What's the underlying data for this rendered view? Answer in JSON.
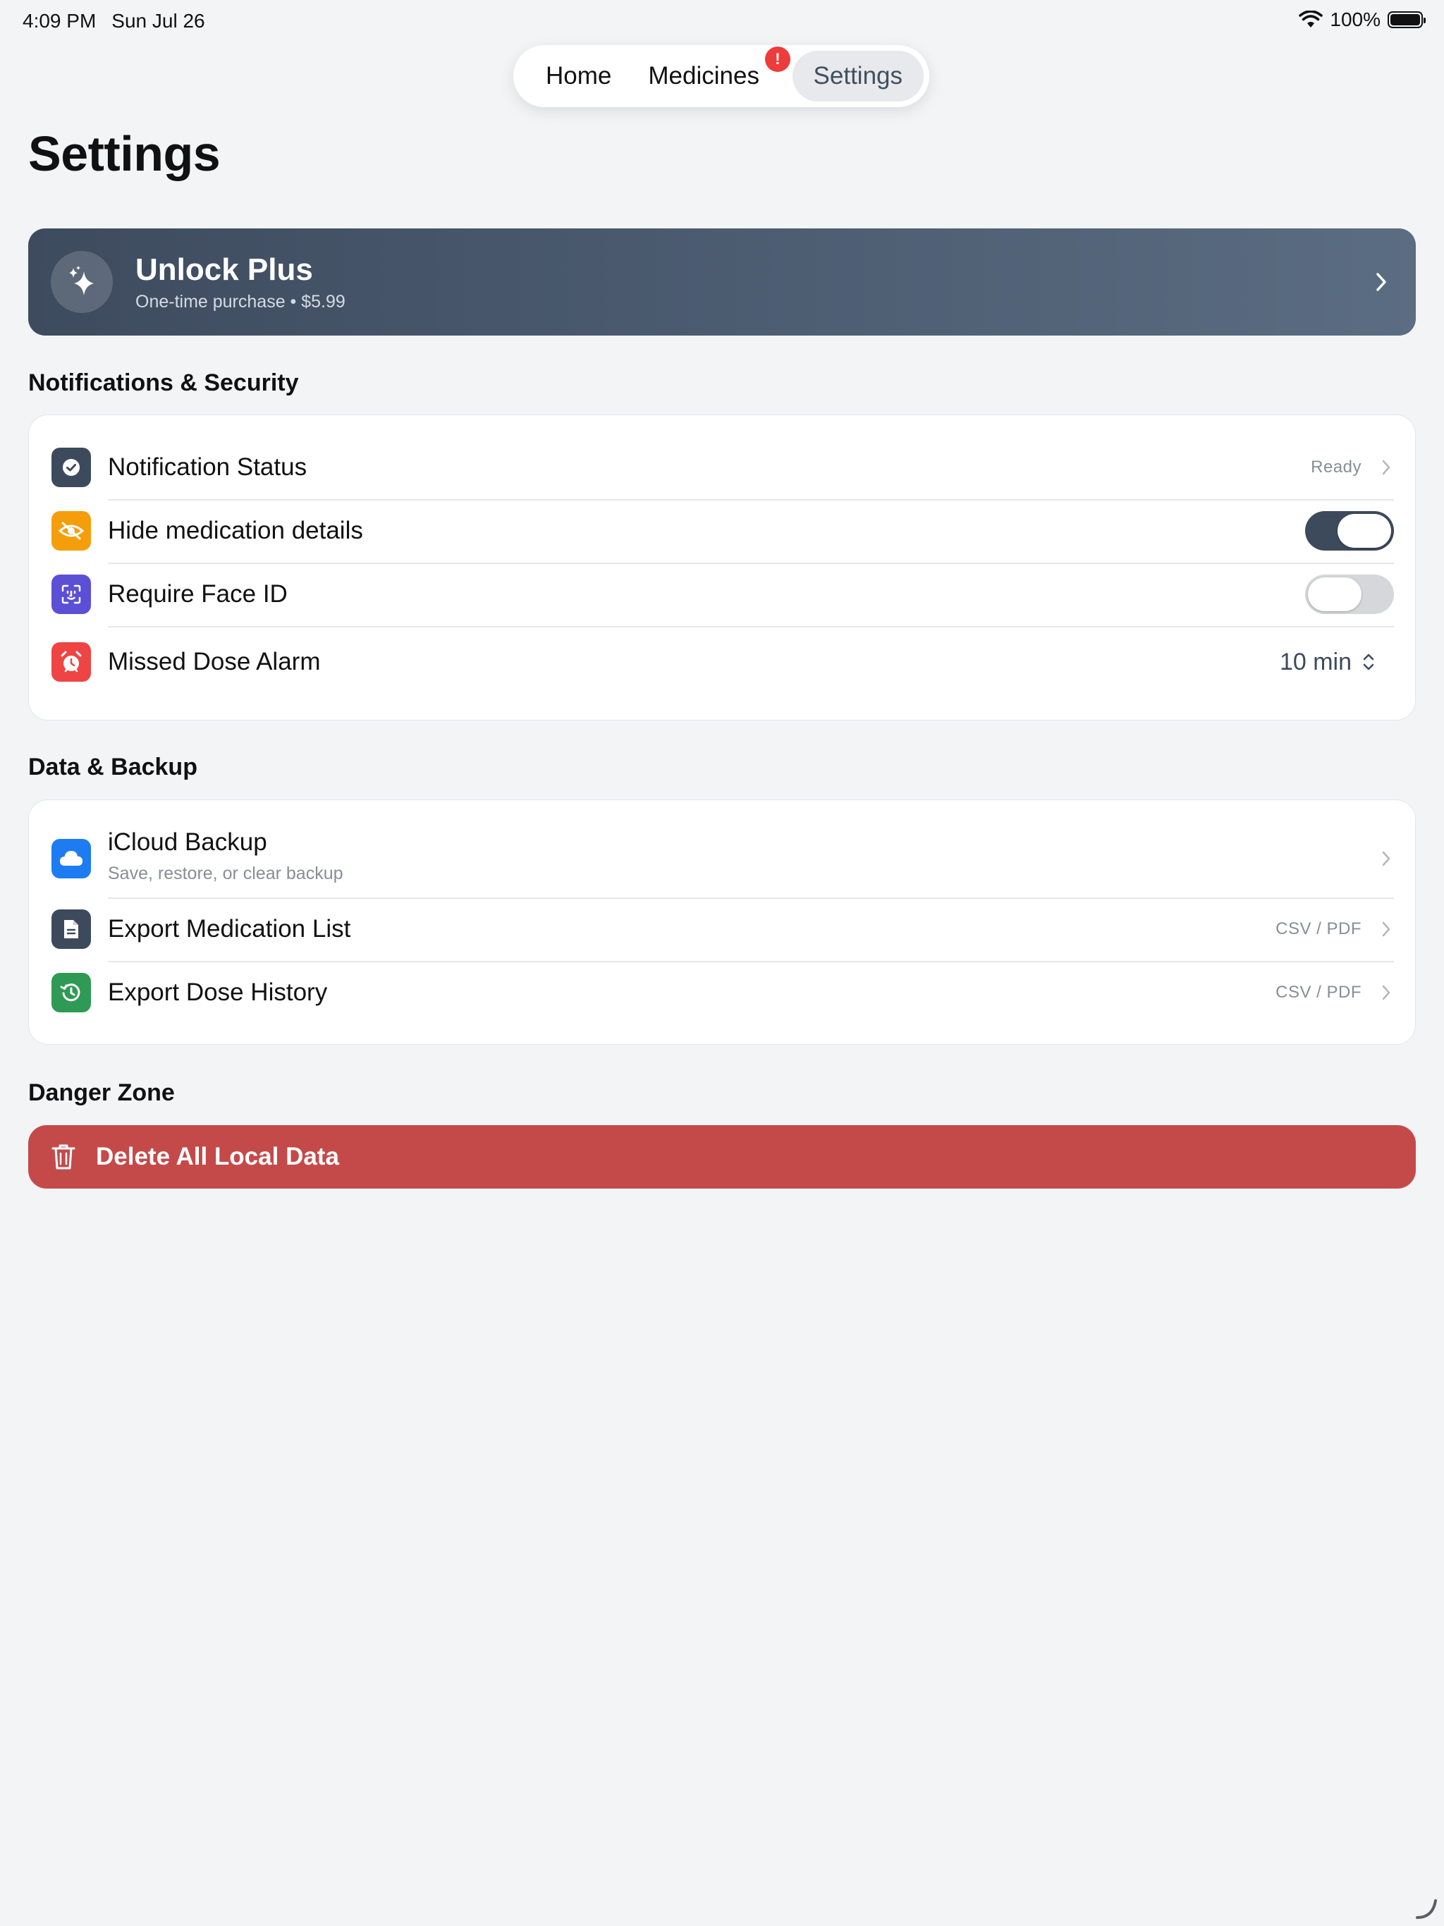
{
  "status_bar": {
    "time": "4:09 PM",
    "date": "Sun Jul 26",
    "battery": "100%"
  },
  "tabs": [
    {
      "label": "Home",
      "active": false
    },
    {
      "label": "Medicines",
      "active": false,
      "badge": "!"
    },
    {
      "label": "Settings",
      "active": true
    }
  ],
  "page_title": "Settings",
  "plus": {
    "title": "Unlock Plus",
    "subtitle": "One-time purchase • $5.99"
  },
  "notifications_section": {
    "title": "Notifications & Security",
    "rows": [
      {
        "label": "Notification Status",
        "value": "Ready",
        "icon": "check-circle-icon",
        "color": "#3d4a5c"
      },
      {
        "label": "Hide medication details",
        "toggle": true,
        "icon": "eye-slash-icon",
        "color": "#f59e0b"
      },
      {
        "label": "Require Face ID",
        "toggle": false,
        "icon": "face-id-icon",
        "color": "#5b4fd6"
      },
      {
        "label": "Missed Dose Alarm",
        "value": "10 min",
        "icon": "alarm-icon",
        "color": "#ef4444"
      }
    ]
  },
  "data_section": {
    "title": "Data & Backup",
    "rows": [
      {
        "label": "iCloud Backup",
        "sublabel": "Save, restore, or clear backup",
        "icon": "cloud-icon",
        "color": "#1d7cf2"
      },
      {
        "label": "Export Medication List",
        "value": "CSV / PDF",
        "icon": "document-icon",
        "color": "#3d4a5c"
      },
      {
        "label": "Export Dose History",
        "value": "CSV / PDF",
        "icon": "history-icon",
        "color": "#2e9a55"
      }
    ]
  },
  "danger_section": {
    "title": "Danger Zone",
    "button_label": "Delete All Local Data",
    "color": "#c44a4a"
  }
}
